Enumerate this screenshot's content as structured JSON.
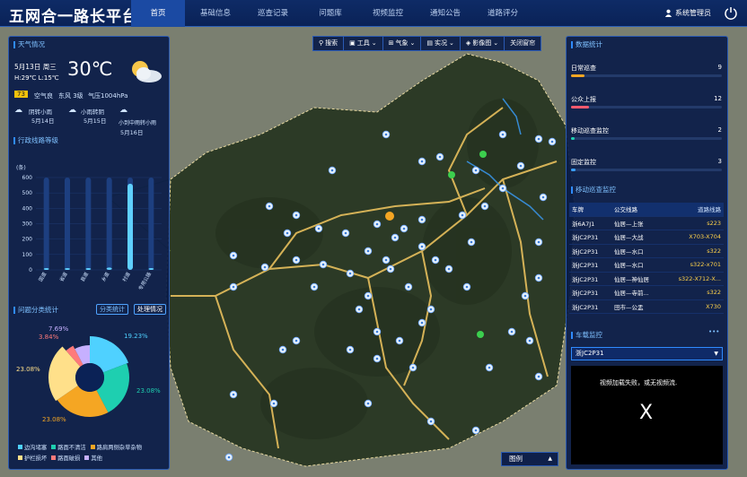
{
  "header": {
    "title": "五网合一路长平台",
    "nav": [
      "首页",
      "基础信息",
      "巡查记录",
      "问题库",
      "视频监控",
      "通知公告",
      "道路评分"
    ],
    "user": "系统管理员"
  },
  "weather": {
    "title": "天气情况",
    "date": "5月13日 周三",
    "temp": "30℃",
    "hilo": "H:29℃  L:15℃",
    "aqi": "73",
    "aqi_text": "空气良",
    "wind": "东风 3级",
    "pressure": "气压1004hPa",
    "forecast": [
      {
        "desc": "阴转小雨",
        "date": "5月14日"
      },
      {
        "desc": "小雨转阴",
        "date": "5月15日"
      },
      {
        "desc": "小到中雨转小雨",
        "date": "5月16日"
      }
    ]
  },
  "road_chart": {
    "title": "行政线路等级",
    "unit": "(条)"
  },
  "chart_data": [
    {
      "type": "bar",
      "title": "行政线路等级",
      "ylabel": "(条)",
      "ylim": [
        0,
        600
      ],
      "yticks": [
        0,
        100,
        200,
        300,
        400,
        500,
        600
      ],
      "categories": [
        "国道",
        "省道",
        "县道",
        "乡道",
        "村道",
        "专用公路"
      ],
      "values": [
        5,
        3,
        10,
        15,
        560,
        2
      ]
    },
    {
      "type": "pie",
      "title": "问题分类统计",
      "labels": [
        "边沟堵塞",
        "路面不清洁",
        "路肩两侧杂草杂物",
        "护栏损坏",
        "路面破损",
        "其他"
      ],
      "values": [
        19.23,
        23.08,
        23.08,
        23.08,
        3.84,
        7.69
      ],
      "colors": [
        "#4fd1ff",
        "#1ecfb0",
        "#f5a623",
        "#ffe08a",
        "#ff7a7a",
        "#c6b0ff"
      ]
    }
  ],
  "issues": {
    "title": "问题分类统计",
    "btn1": "分类统计",
    "btn2": "处理情况",
    "labels": {
      "p1": "19.23%",
      "p2": "23.08%",
      "p3": "23.08%",
      "p4": "23.08%",
      "p5": "3.84%",
      "p6": "7.69%"
    }
  },
  "data_stats": {
    "title": "数据统计",
    "items": [
      {
        "label": "日常巡查",
        "value": "9",
        "pct": 0.09,
        "color": "#f5a623"
      },
      {
        "label": "公众上报",
        "value": "12",
        "pct": 0.12,
        "color": "#ff5a6e"
      },
      {
        "label": "移动巡查监控",
        "value": "2",
        "pct": 0.02,
        "color": "#1ecfb0"
      },
      {
        "label": "固定监控",
        "value": "3",
        "pct": 0.03,
        "color": "#3aa0ff"
      }
    ]
  },
  "mobile": {
    "title": "移动巡查监控",
    "headers": [
      "车牌",
      "公交线路",
      "道路线路"
    ],
    "rows": [
      [
        "浙6A7J1",
        "仙居—上张",
        "s223"
      ],
      [
        "浙JC2P31",
        "仙居—大战",
        "X703-X704"
      ],
      [
        "浙JC2P31",
        "仙居—水口",
        "s322"
      ],
      [
        "浙JC2P31",
        "仙居—水口",
        "s322-x701"
      ],
      [
        "浙JC2P31",
        "仙居—神仙居",
        "s322-X712-X..."
      ],
      [
        "浙JC2P31",
        "仙居—寺前...",
        "s322"
      ],
      [
        "浙JC2P31",
        "田市—公盂",
        "X730"
      ]
    ]
  },
  "vehicle": {
    "title": "车载监控",
    "selected": "浙JC2P31",
    "video_msg": "视频加载失败，或无视频流.",
    "close": "X",
    "more": "•••"
  },
  "toolbar": [
    "搜索",
    "工具",
    "气象",
    "实况",
    "影像图",
    "关闭窗帘"
  ],
  "map_legend": "图例"
}
